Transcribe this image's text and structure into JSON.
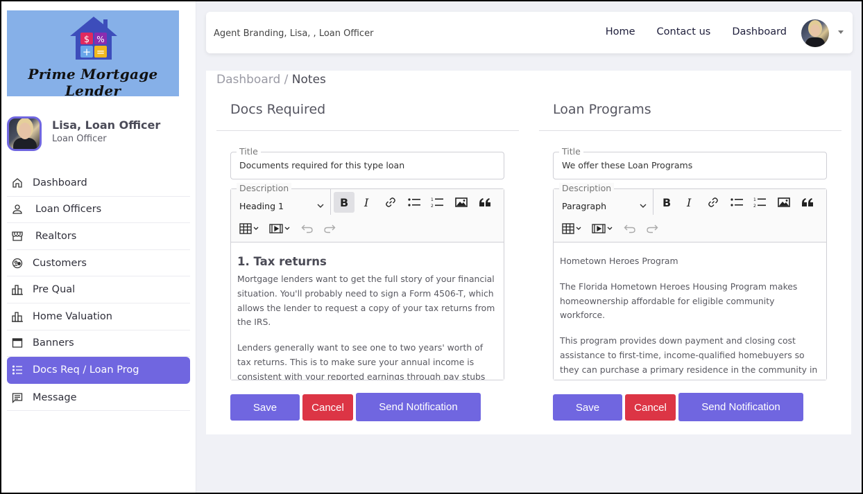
{
  "brand": {
    "name": "Prime Mortgage Lender",
    "logo_symbols": [
      "$",
      "%",
      "+",
      "="
    ],
    "colors": {
      "logo_bg": "#86b0e8",
      "house": "#3d4dbb",
      "accent": "#7066e0",
      "danger": "#dc3545"
    }
  },
  "profile": {
    "name": "Lisa, Loan Officer",
    "role": "Loan Officer"
  },
  "sidebar": {
    "items": [
      {
        "label": "Dashboard",
        "icon": "home-icon",
        "active": false
      },
      {
        "label": "Loan Officers",
        "icon": "user-icon",
        "active": false
      },
      {
        "label": "Realtors",
        "icon": "store-icon",
        "active": false
      },
      {
        "label": "Customers",
        "icon": "customers-icon",
        "active": false
      },
      {
        "label": "Pre Qual",
        "icon": "bar-chart-icon",
        "active": false
      },
      {
        "label": "Home Valuation",
        "icon": "bar-chart-icon",
        "active": false
      },
      {
        "label": "Banners",
        "icon": "window-icon",
        "active": false
      },
      {
        "label": "Docs Req / Loan Prog",
        "icon": "list-icon",
        "active": true
      },
      {
        "label": "Message",
        "icon": "message-icon",
        "active": false
      }
    ]
  },
  "topbar": {
    "title": "Agent Branding, Lisa, , Loan Officer",
    "nav": [
      "Home",
      "Contact us",
      "Dashboard"
    ]
  },
  "breadcrumb": {
    "parent": "Dashboard",
    "separator": " / ",
    "current": "Notes"
  },
  "sections": [
    {
      "heading": "Docs Required",
      "title_legend": "Title",
      "title_value": "Documents required for this type loan",
      "description_legend": "Description",
      "format_select": "Heading 1",
      "bold_active": true,
      "content": {
        "heading": "1. Tax returns",
        "paragraphs": [
          "Mortgage lenders want to get the full story of your financial situation. You'll probably need to sign a Form 4506-T, which allows the lender to request a copy of your tax returns from the IRS.",
          "Lenders generally want to see one to two years' worth of tax returns. This is to make sure your annual income is consistent with your reported earnings through pay stubs and there"
        ]
      },
      "buttons": {
        "save": "Save",
        "cancel": "Cancel",
        "notify": "Send Notification"
      }
    },
    {
      "heading": "Loan Programs",
      "title_legend": "Title",
      "title_value": "We offer these Loan Programs",
      "description_legend": "Description",
      "format_select": "Paragraph",
      "bold_active": false,
      "content": {
        "heading": "",
        "paragraphs": [
          "Hometown Heroes Program",
          "The Florida Hometown Heroes Housing Program makes homeownership affordable for eligible community workforce.",
          "This program provides down payment and closing cost assistance to first-time, income-qualified homebuyers so they can purchase a primary residence in the community in which they work and serve. The Florida Hometown Heroes Loan"
        ]
      },
      "buttons": {
        "save": "Save",
        "cancel": "Cancel",
        "notify": "Send Notification"
      }
    }
  ]
}
